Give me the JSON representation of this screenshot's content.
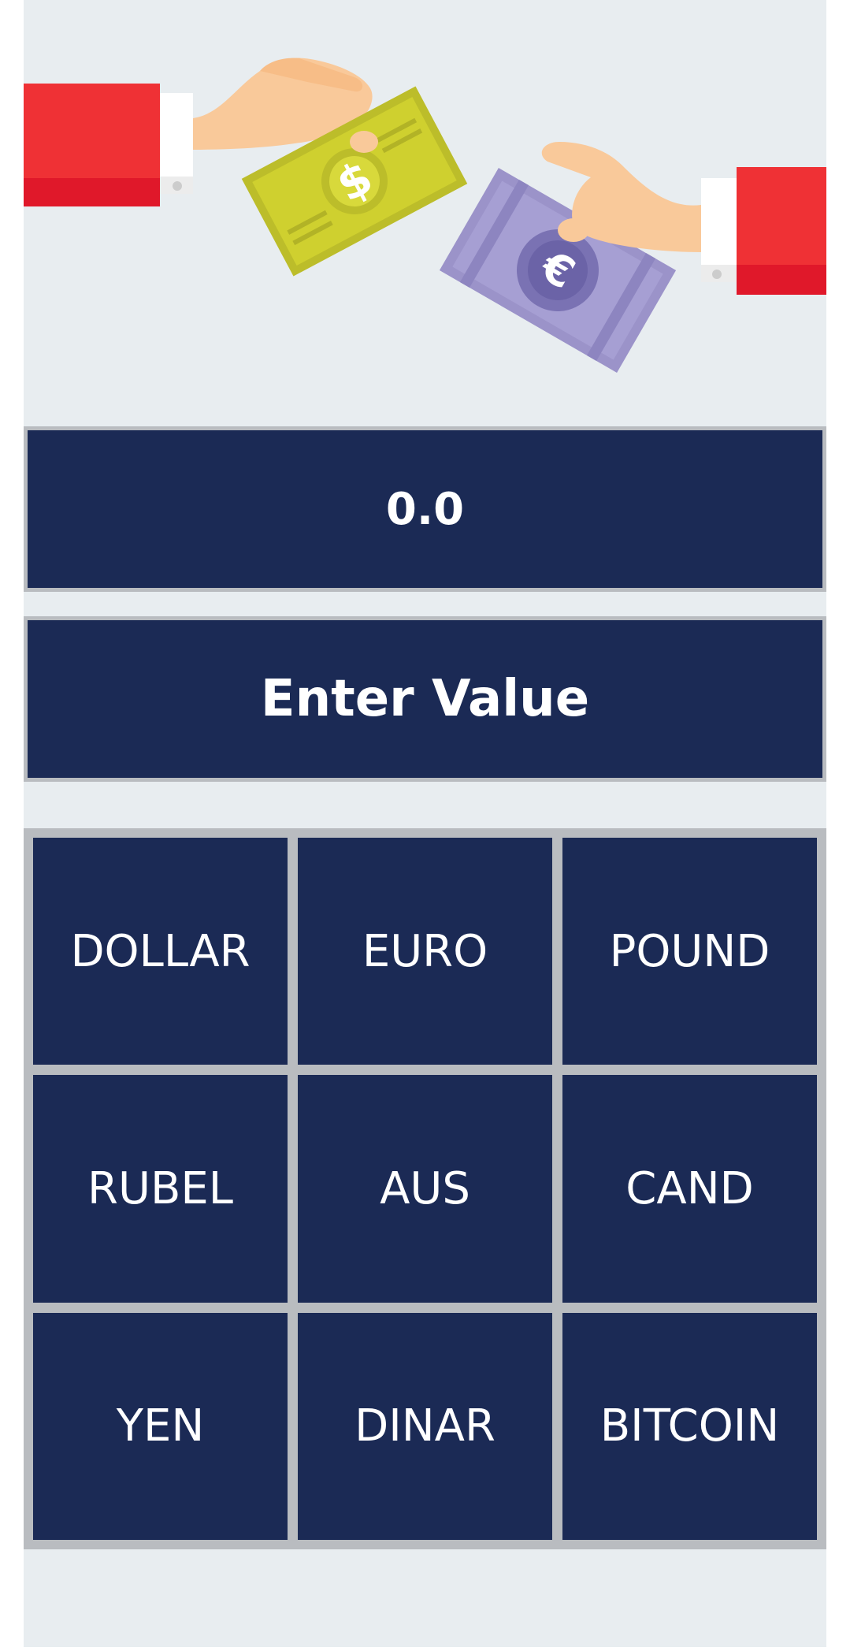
{
  "result": {
    "value": "0.0"
  },
  "input": {
    "placeholder": "Enter Value",
    "value": ""
  },
  "currencies": [
    {
      "label": "DOLLAR"
    },
    {
      "label": "EURO"
    },
    {
      "label": "POUND"
    },
    {
      "label": "RUBEL"
    },
    {
      "label": "AUS"
    },
    {
      "label": "CAND"
    },
    {
      "label": "YEN"
    },
    {
      "label": "DINAR"
    },
    {
      "label": "BITCOIN"
    }
  ],
  "colors": {
    "background": "#e8edf0",
    "panel": "#1b2a55",
    "border": "#b9bcc0",
    "text": "#ffffff"
  },
  "hero_icons": [
    "dollar-bill-icon",
    "euro-bill-icon",
    "hand-icon"
  ]
}
